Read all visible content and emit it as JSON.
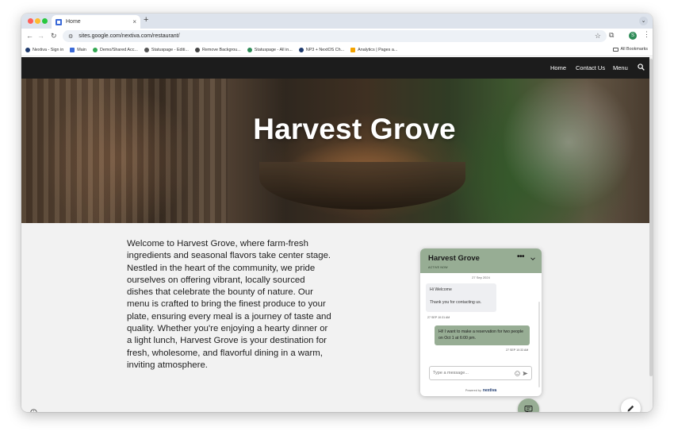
{
  "browser": {
    "tab_title": "Home",
    "tab_close": "×",
    "new_tab": "+",
    "url": "sites.google.com/nextiva.com/restaurant/",
    "profile_initial": "S",
    "bookmarks": [
      {
        "label": "Nextiva - Sign in",
        "icon": "nextiva-x-icon",
        "color": "#1e3a6e"
      },
      {
        "label": "Main",
        "icon": "google-sites-icon",
        "color": "#3b6ad8"
      },
      {
        "label": "Demo/Shared Acc...",
        "icon": "google-drive-icon",
        "color": "#34a853"
      },
      {
        "label": "Statuspage - Editi...",
        "icon": "globe-icon",
        "color": "#555555"
      },
      {
        "label": "Remove Backgrou...",
        "icon": "eye-icon",
        "color": "#444444"
      },
      {
        "label": "Statuspage - All in...",
        "icon": "wifi-icon",
        "color": "#2e8b57"
      },
      {
        "label": "NP3 + NextOS Ch...",
        "icon": "nextiva-x-icon",
        "color": "#1e3a6e"
      },
      {
        "label": "Analytics | Pages a...",
        "icon": "analytics-icon",
        "color": "#f4a300"
      }
    ],
    "all_bookmarks": "All Bookmarks"
  },
  "site": {
    "nav": {
      "home": "Home",
      "contact": "Contact Us",
      "menu": "Menu"
    },
    "hero_title": "Harvest Grove",
    "intro": "Welcome to Harvest Grove, where farm-fresh ingredients and seasonal flavors take center stage. Nestled in the heart of the community, we pride ourselves on offering vibrant, locally sourced dishes that celebrate the bounty of nature. Our menu is crafted to bring the finest produce to your plate, ensuring every meal is a journey of taste and quality. Whether you're enjoying a hearty dinner or a light lunch, Harvest Grove is your destination for fresh, wholesome, and flavorful dining in a warm, inviting atmosphere."
  },
  "chat": {
    "title": "Harvest Grove",
    "status": "ACTIVE NOW",
    "more": "•••",
    "date": "27 Sep 2024",
    "incoming": {
      "line1": "Hi Welcome",
      "line2": "Thank you for contacting us.",
      "time": "27 SEP 10:31 AM"
    },
    "outgoing": {
      "text": "Hi! I want to make a reservation for two people on Oct 1 at 6:00 pm.",
      "time": "27 SEP 10:33 AM"
    },
    "input_placeholder": "Type a message...",
    "powered_by": "Powered by",
    "brand": "nextiva"
  },
  "colors": {
    "chat_accent": "#97ad94",
    "nav_bg": "#1c1c1c",
    "page_bg": "#f2f2f2"
  }
}
